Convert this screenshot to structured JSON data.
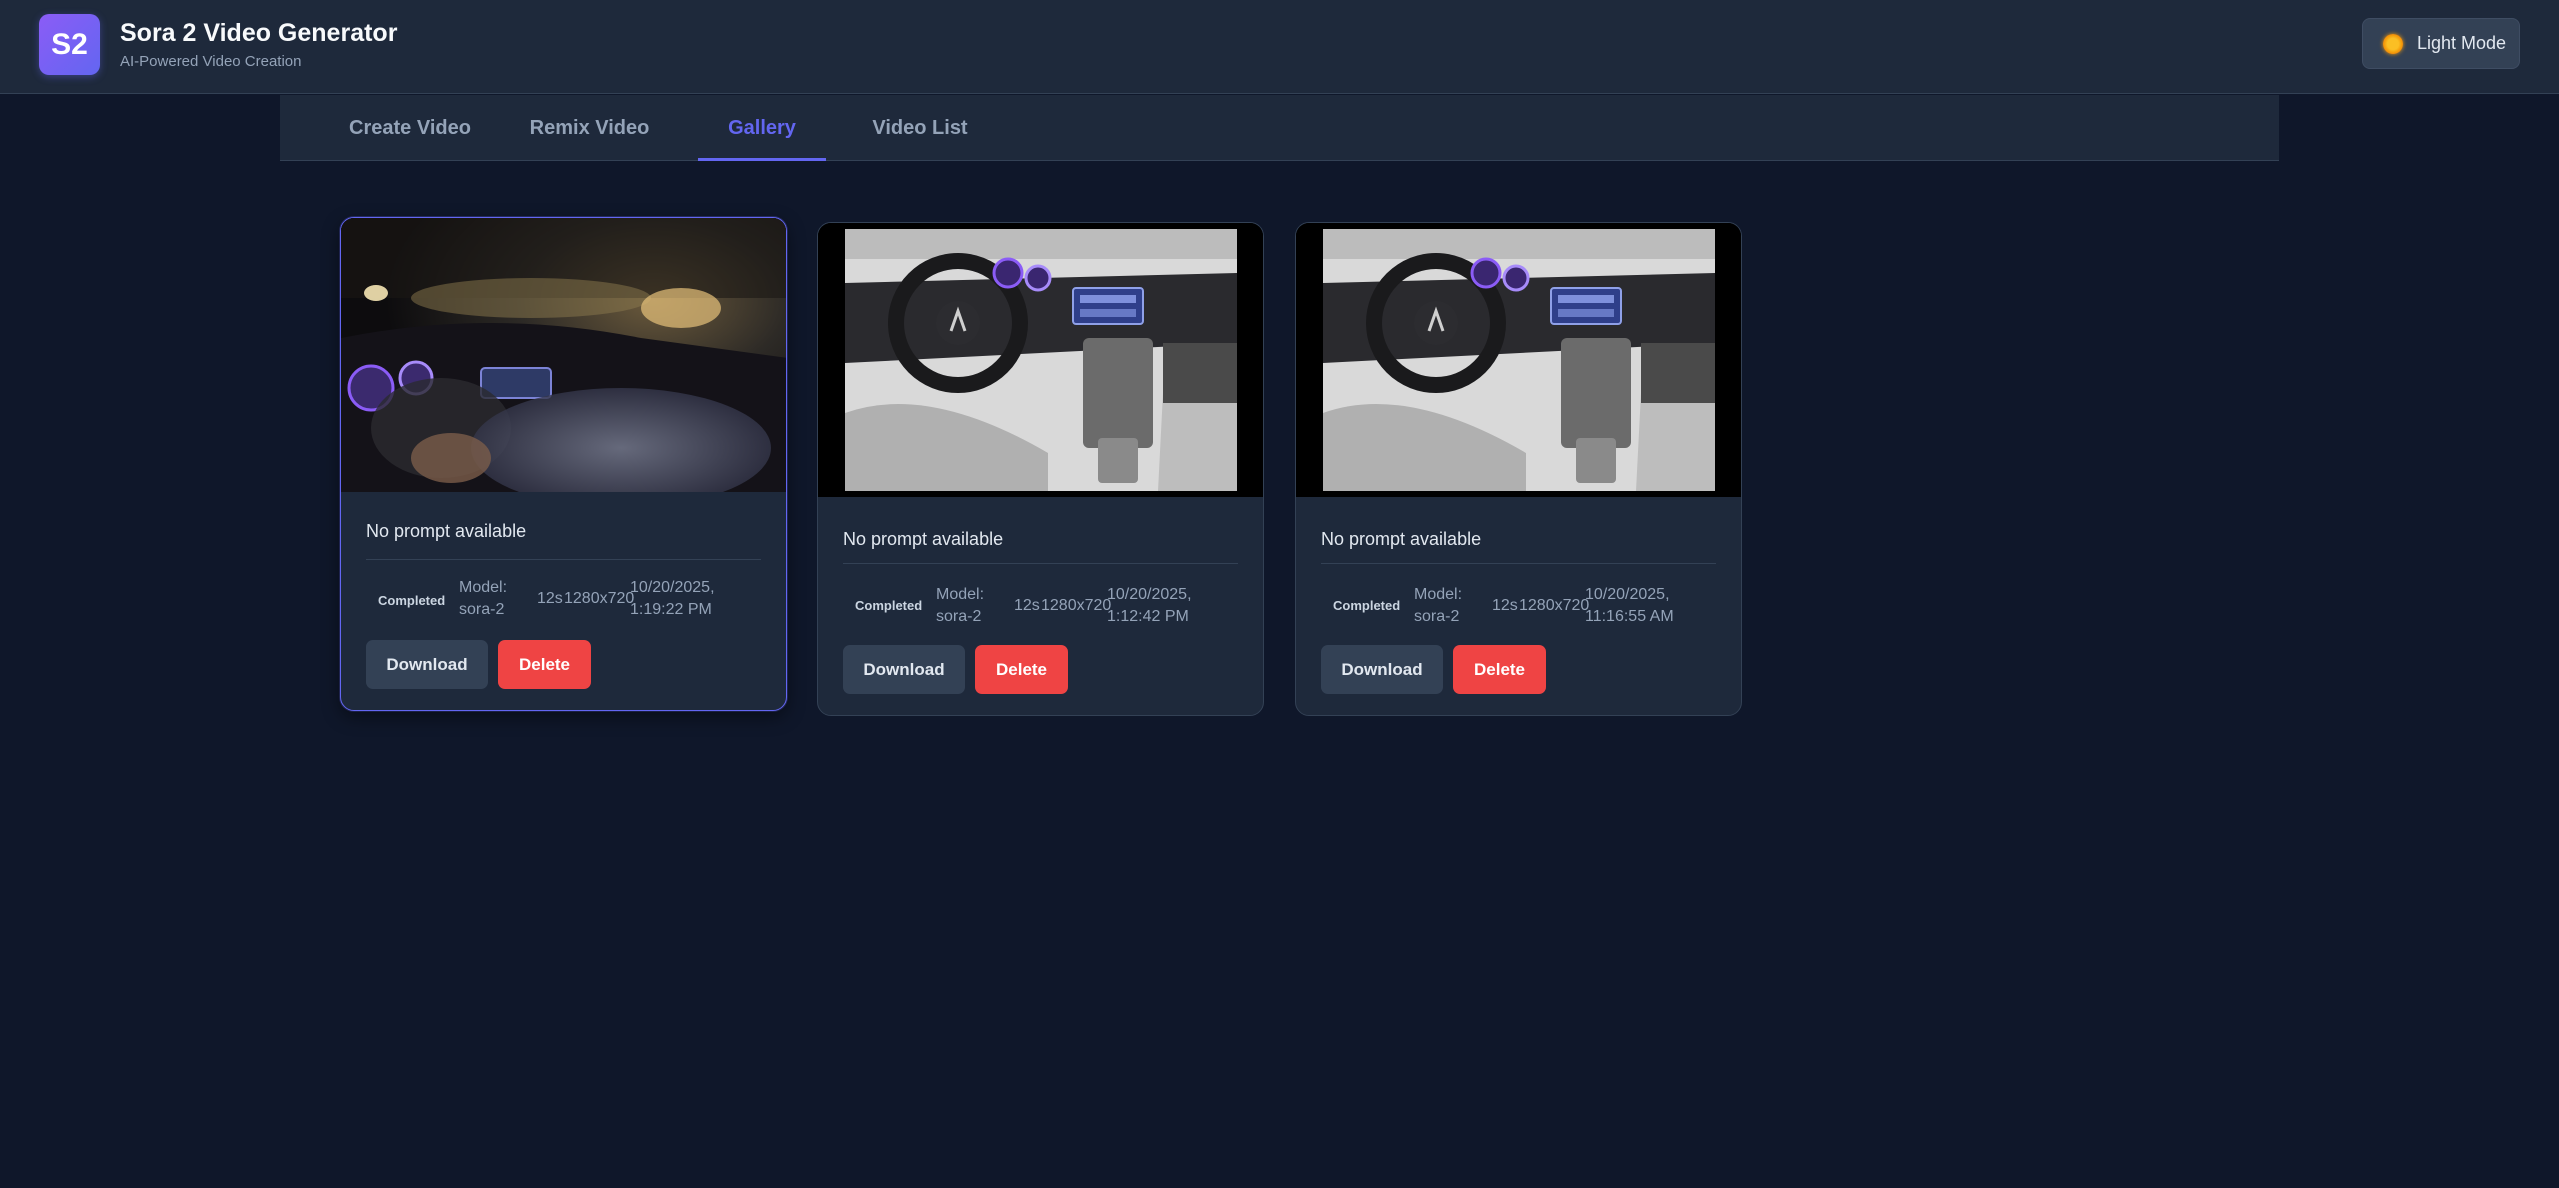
{
  "header": {
    "logo_text": "S2",
    "title": "Sora 2 Video Generator",
    "subtitle": "AI-Powered Video Creation",
    "theme_button_label": "Light Mode",
    "theme_icon": "sun-icon"
  },
  "tabs": [
    {
      "label": "Create Video",
      "active": false
    },
    {
      "label": "Remix Video",
      "active": false
    },
    {
      "label": "Gallery",
      "active": true
    },
    {
      "label": "Video List",
      "active": false
    }
  ],
  "colors": {
    "background": "#0f172a",
    "surface": "#1e293b",
    "accent": "#6366f1",
    "danger": "#ef4444"
  },
  "gallery": [
    {
      "thumbnail": "night-driving-video-frame",
      "prompt": "No prompt available",
      "status": "Completed",
      "model_line1": "Model:",
      "model_line2": "sora-2",
      "duration": "12s",
      "resolution": "1280x720",
      "date_line1": "10/20/2025,",
      "date_line2": "1:19:22 PM",
      "download_label": "Download",
      "delete_label": "Delete",
      "selected": true
    },
    {
      "thumbnail": "car-interior-dashboard-image",
      "prompt": "No prompt available",
      "status": "Completed",
      "model_line1": "Model:",
      "model_line2": "sora-2",
      "duration": "12s",
      "resolution": "1280x720",
      "date_line1": "10/20/2025,",
      "date_line2": "1:12:42 PM",
      "download_label": "Download",
      "delete_label": "Delete",
      "selected": false
    },
    {
      "thumbnail": "car-interior-dashboard-image",
      "prompt": "No prompt available",
      "status": "Completed",
      "model_line1": "Model:",
      "model_line2": "sora-2",
      "duration": "12s",
      "resolution": "1280x720",
      "date_line1": "10/20/2025,",
      "date_line2": "11:16:55 AM",
      "download_label": "Download",
      "delete_label": "Delete",
      "selected": false
    }
  ]
}
